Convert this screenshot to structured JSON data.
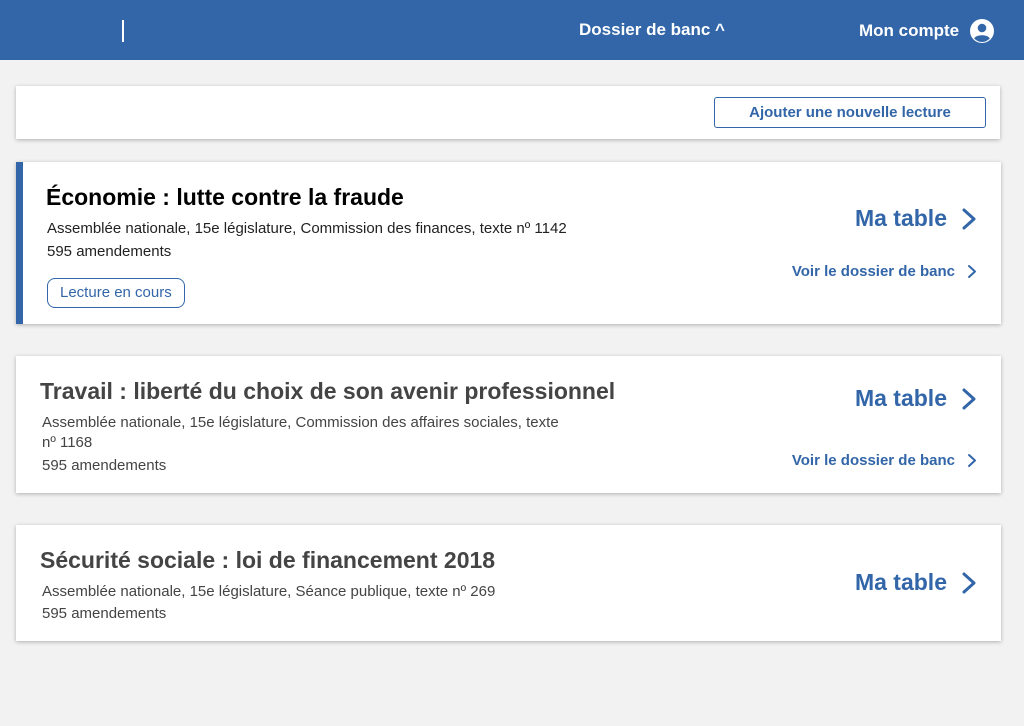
{
  "header": {
    "nav_dossier": "Dossier de banc ^",
    "account_label": "Mon compte"
  },
  "toolbar": {
    "add_button": "Ajouter une nouvelle lecture"
  },
  "lectures": [
    {
      "title": "Économie : lutte contre la fraude",
      "description": "Assemblée nationale, 15e législature, Commission des finances, texte nº 1142",
      "amendments": "595 amendements",
      "status": "Lecture en cours",
      "ma_table": "Ma table",
      "voir_dossier": "Voir le dossier de banc"
    },
    {
      "title": "Travail : liberté du choix de son avenir professionnel",
      "description": "Assemblée nationale, 15e législature, Commission des affaires sociales, texte nº 1168",
      "amendments": "595 amendements",
      "ma_table": "Ma table",
      "voir_dossier": "Voir le dossier de banc"
    },
    {
      "title": "Sécurité sociale : loi de financement 2018",
      "description": "Assemblée nationale, 15e législature, Séance publique, texte nº 269",
      "amendments": "595 amendements",
      "ma_table": "Ma table"
    }
  ],
  "colors": {
    "primary": "#3266a8",
    "background": "#f2f2f2",
    "card": "#ffffff"
  },
  "icons": {
    "account": "account-circle-icon",
    "chevron": "chevron-right-icon"
  }
}
